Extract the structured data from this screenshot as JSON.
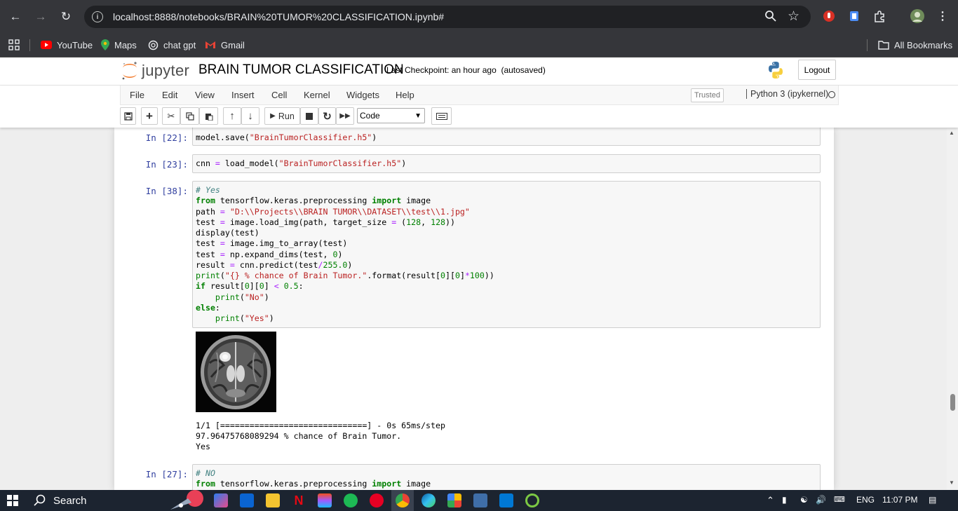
{
  "browser": {
    "url": "localhost:8888/notebooks/BRAIN%20TUMOR%20CLASSIFICATION.ipynb#",
    "bookmarks": [
      "YouTube",
      "Maps",
      "chat gpt",
      "Gmail"
    ],
    "all_bookmarks": "All Bookmarks"
  },
  "jupyter": {
    "logo_text": "jupyter",
    "notebook_title": "BRAIN TUMOR CLASSIFICATION",
    "checkpoint": "Last Checkpoint: an hour ago",
    "autosave": "(autosaved)",
    "logout": "Logout",
    "menu": [
      "File",
      "Edit",
      "View",
      "Insert",
      "Cell",
      "Kernel",
      "Widgets",
      "Help"
    ],
    "trusted": "Trusted",
    "kernel": "Python 3 (ipykernel)",
    "run_label": "Run",
    "cell_type": "Code"
  },
  "cells": [
    {
      "prompt": "In [22]:"
    },
    {
      "prompt": "In [23]:"
    },
    {
      "prompt": "In [38]:"
    },
    {
      "prompt": "In [27]:"
    }
  ],
  "outputs": {
    "progress": "1/1 [==============================] - 0s 65ms/step",
    "chance": "97.96475768089294 % chance of Brain Tumor.",
    "answer": "Yes"
  },
  "taskbar": {
    "search": "Search",
    "lang": "ENG",
    "time": "11:07 PM"
  }
}
